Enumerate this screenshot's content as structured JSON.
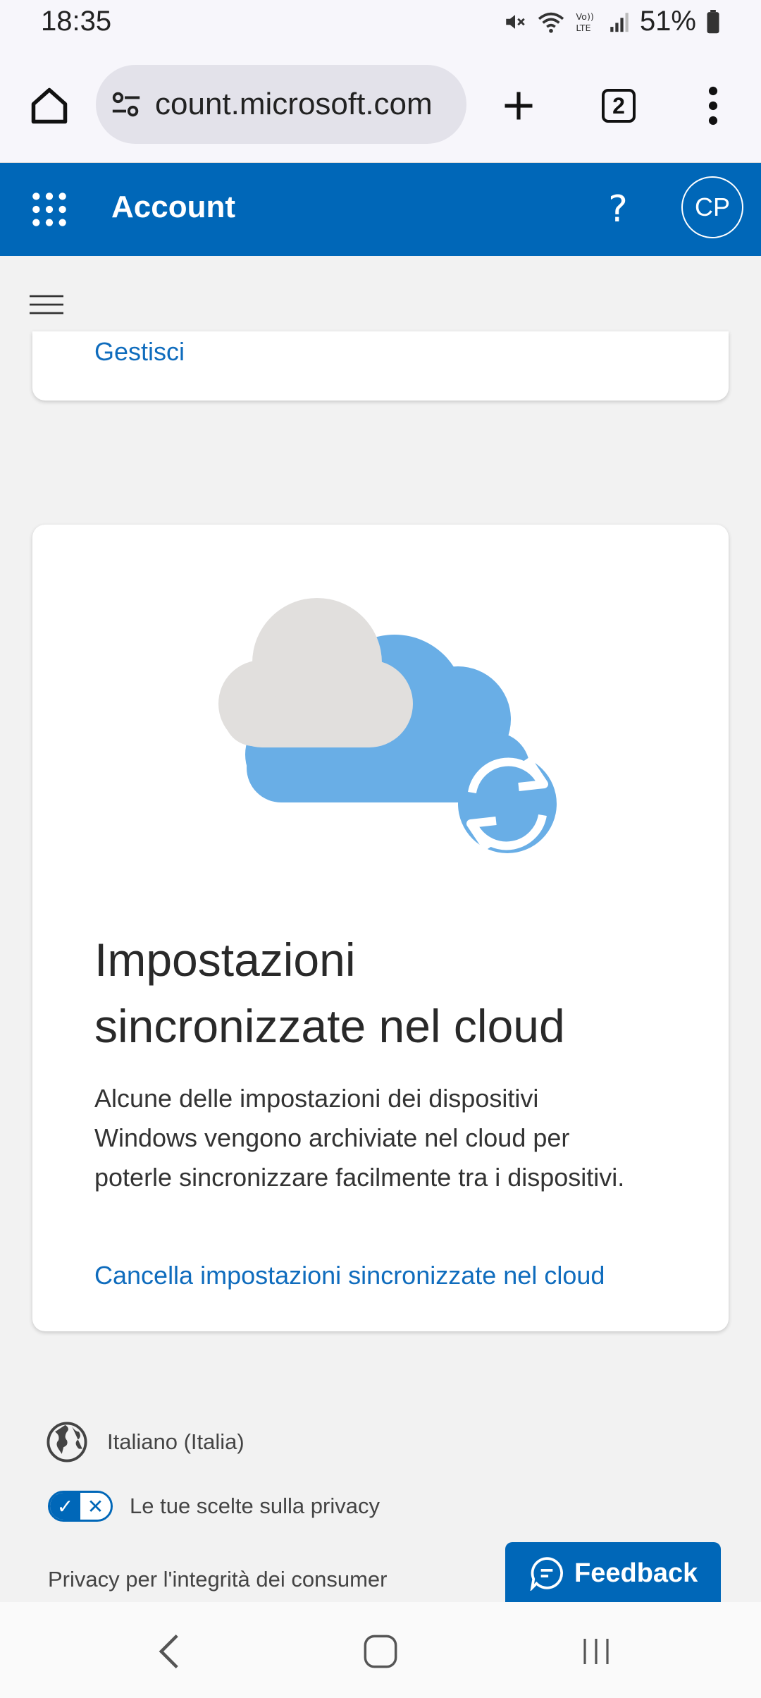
{
  "status": {
    "time": "18:35",
    "battery": "51%"
  },
  "browser": {
    "url": "count.microsoft.com",
    "tab_count": "2"
  },
  "header": {
    "title": "Account",
    "avatar_initials": "CP"
  },
  "card_top": {
    "link": "Gestisci"
  },
  "card_main": {
    "title_line1": "Impostazioni",
    "title_line2": "sincronizzate nel cloud",
    "description": "Alcune delle impostazioni dei dispositivi Windows vengono archiviate nel cloud per poterle sincronizzare facilmente tra i dispositivi.",
    "link": "Cancella impostazioni sincronizzate nel cloud"
  },
  "footer": {
    "language": "Italiano (Italia)",
    "privacy_choices": "Le tue scelte sulla privacy",
    "consumer_health": "Privacy per l'integrità dei consumer",
    "feedback": "Feedback"
  },
  "colors": {
    "brand": "#0067b8",
    "link": "#0f6cbd",
    "cloud_blue": "#69aee6",
    "cloud_gray": "#e1dfdd"
  }
}
